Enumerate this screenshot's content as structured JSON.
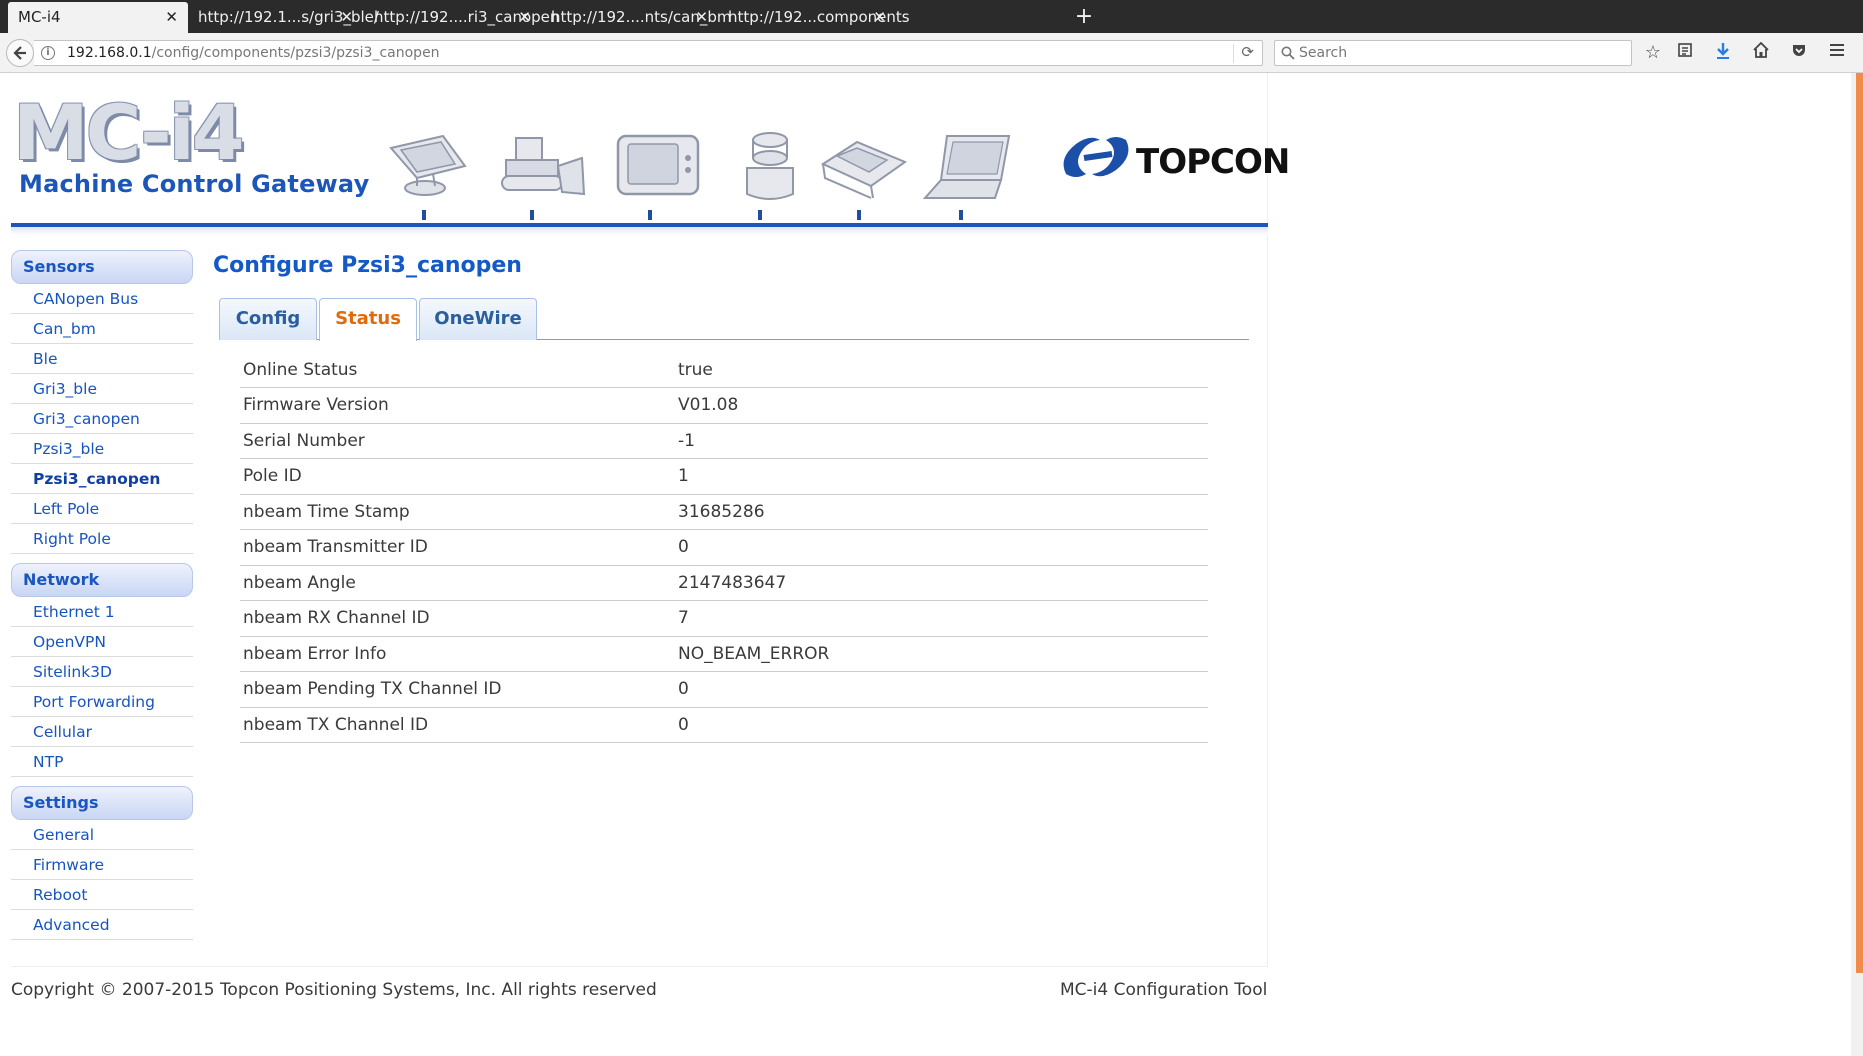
{
  "browser": {
    "tabs": [
      {
        "title": "MC-i4"
      },
      {
        "title": "http://192.1...s/gri3_ble/"
      },
      {
        "title": "http://192....ri3_canopen"
      },
      {
        "title": "http://192....nts/can_bm"
      },
      {
        "title": "http://192...components"
      }
    ],
    "close_glyph": "✕",
    "new_tab_glyph": "+",
    "url_host": "192.168.0.1",
    "url_path": "/config/components/pzsi3/pzsi3_canopen",
    "search_placeholder": "Search"
  },
  "header": {
    "logo_title": "MC-i4",
    "logo_subtitle": "Machine Control Gateway",
    "brand": "TOPCON",
    "machine_icons": [
      "paver-icon",
      "bulldozer-icon",
      "display-icon",
      "sensor-icon",
      "grader-icon",
      "laptop-icon"
    ]
  },
  "sidebar": {
    "groups": [
      {
        "title": "Sensors",
        "items": [
          "CANopen Bus",
          "Can_bm",
          "Ble",
          "Gri3_ble",
          "Gri3_canopen",
          "Pzsi3_ble",
          "Pzsi3_canopen",
          "Left Pole",
          "Right Pole"
        ]
      },
      {
        "title": "Network",
        "items": [
          "Ethernet 1",
          "OpenVPN",
          "Sitelink3D",
          "Port Forwarding",
          "Cellular",
          "NTP"
        ]
      },
      {
        "title": "Settings",
        "items": [
          "General",
          "Firmware",
          "Reboot",
          "Advanced"
        ]
      }
    ],
    "current_item": "Pzsi3_canopen"
  },
  "main": {
    "title": "Configure Pzsi3_canopen",
    "tabs": [
      "Config",
      "Status",
      "OneWire"
    ],
    "active_tab": "Status",
    "status_rows": [
      {
        "key": "Online Status",
        "value": "true"
      },
      {
        "key": "Firmware Version",
        "value": "V01.08"
      },
      {
        "key": "Serial Number",
        "value": "-1"
      },
      {
        "key": "Pole ID",
        "value": "1"
      },
      {
        "key": "nbeam Time Stamp",
        "value": "31685286"
      },
      {
        "key": "nbeam Transmitter ID",
        "value": "0"
      },
      {
        "key": "nbeam Angle",
        "value": "2147483647"
      },
      {
        "key": "nbeam RX Channel ID",
        "value": "7"
      },
      {
        "key": "nbeam Error Info",
        "value": "NO_BEAM_ERROR"
      },
      {
        "key": "nbeam Pending TX Channel ID",
        "value": "0"
      },
      {
        "key": "nbeam TX Channel ID",
        "value": "0"
      }
    ]
  },
  "footer": {
    "copyright": "Copyright © 2007-2015 Topcon Positioning Systems, Inc. All rights reserved",
    "tool_name": "MC-i4 Configuration Tool"
  },
  "colors": {
    "accent_blue": "#1c56b8",
    "active_tab_orange": "#e16b0c",
    "scrollbar_orange": "#f08b4a"
  }
}
